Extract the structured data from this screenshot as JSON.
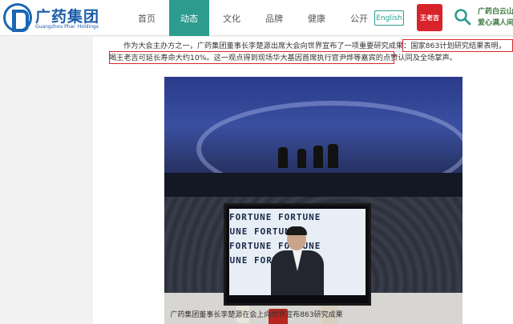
{
  "header": {
    "logo_cn": "广药集团",
    "logo_en": "Guangzhou Phar. Holdings",
    "nav": [
      {
        "label": "首页",
        "active": false
      },
      {
        "label": "动态",
        "active": true
      },
      {
        "label": "文化",
        "active": false
      },
      {
        "label": "品牌",
        "active": false
      },
      {
        "label": "健康",
        "active": false
      },
      {
        "label": "公开",
        "active": false
      }
    ],
    "lang_button": "English",
    "seal_text": "王老吉",
    "brand_right_line1": "广药白云山",
    "brand_right_line2": "爱心满人间"
  },
  "article": {
    "paragraph_plain": "作为大会主办方之一，广药集团董事长李楚源出席大会向世界宣布了一项重要研究成果：",
    "highlight_1": "国家863计划研究结果表明，喝王",
    "highlight_2": "老吉可延长寿命大约10%。",
    "paragraph_tail": "这一观点得到现场华大基因首席执行官尹烨等嘉宾的点赞认同及全场掌声。",
    "screen_text": "FORTUNE",
    "caption": "广药集团董事长李楚源在会上向世界宣布863研究成果"
  },
  "colors": {
    "nav_active": "#2d9c8f",
    "highlight_border": "#d9262c",
    "logo_blue": "#1a5ca8",
    "seal_red": "#d8232a"
  }
}
